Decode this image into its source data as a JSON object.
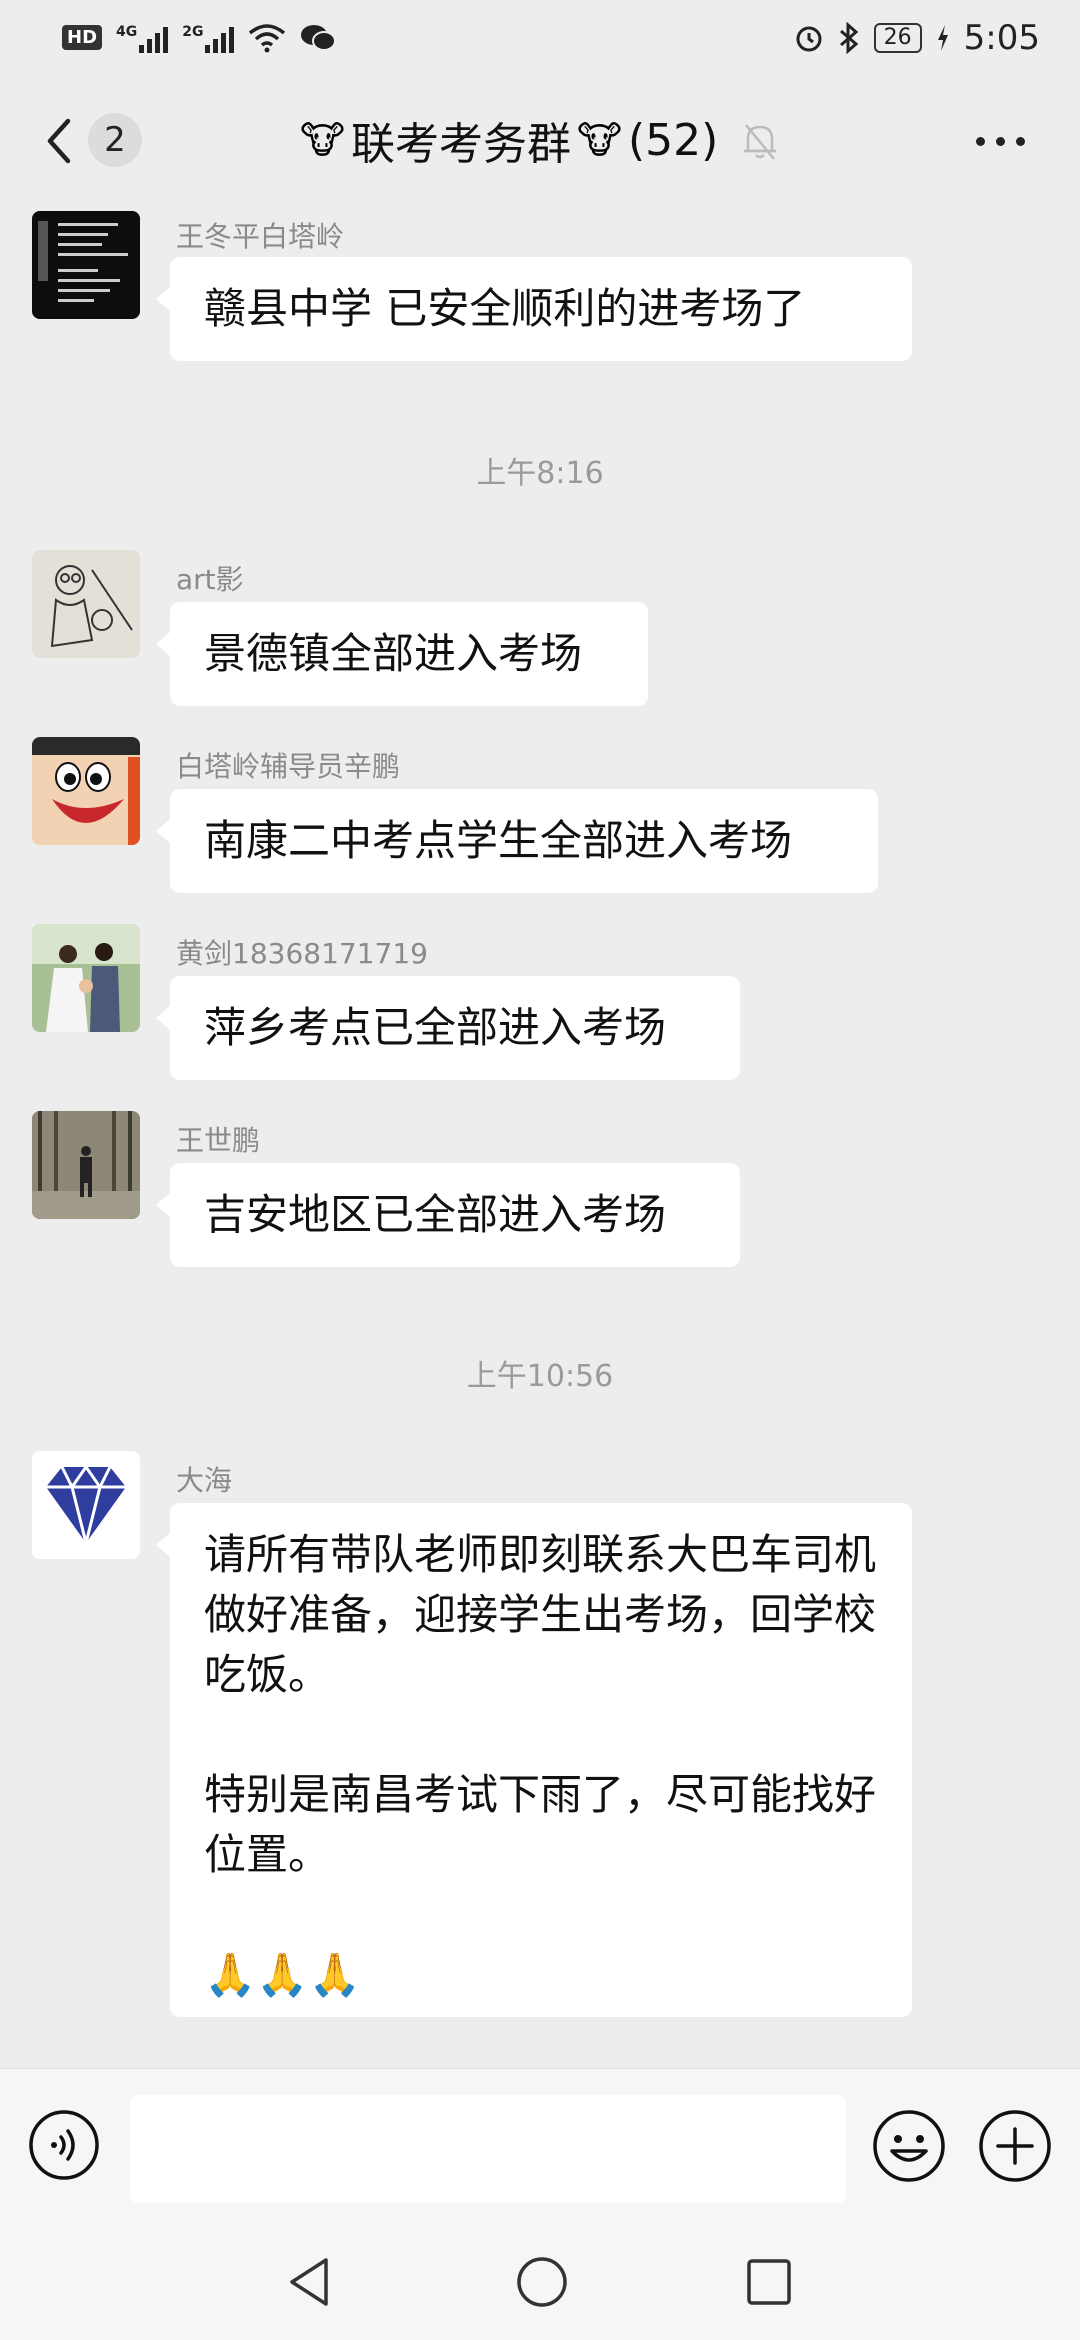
{
  "status_bar": {
    "hd": "HD",
    "network1": "4G",
    "network2": "2G",
    "battery": "26",
    "time": "5:05"
  },
  "header": {
    "unread_count": "2",
    "title": "联考考务群",
    "member_count": "(52)",
    "title_emoji": "🐮"
  },
  "messages": [
    {
      "sender": "王冬平白塔岭",
      "text": "赣县中学 已安全顺利的进考场了"
    },
    {
      "timestamp": "上午8:16"
    },
    {
      "sender": "art影",
      "text": "景德镇全部进入考场"
    },
    {
      "sender": "白塔岭辅导员辛鹏",
      "text": "南康二中考点学生全部进入考场"
    },
    {
      "sender": "黄剑18368171719",
      "text": "萍乡考点已全部进入考场"
    },
    {
      "sender": "王世鹏",
      "text": "吉安地区已全部进入考场"
    },
    {
      "timestamp": "上午10:56"
    },
    {
      "sender": "大海",
      "paragraphs": [
        "请所有带队老师即刻联系大巴车司机做好准备，迎接学生出考场，回学校吃饭。",
        "特别是南昌考试下雨了，尽可能找好位置。",
        "🙏🙏🙏"
      ]
    }
  ],
  "input": {
    "value": "",
    "placeholder": ""
  },
  "icons": {
    "back": "chevron-left-icon",
    "mute": "bell-off-icon",
    "more": "more-horizontal-icon",
    "voice": "voice-icon",
    "emoji": "emoji-icon",
    "plus": "plus-icon"
  },
  "colors": {
    "background": "#ededed",
    "bubble": "#ffffff",
    "diamond": "#2f3d9e"
  }
}
